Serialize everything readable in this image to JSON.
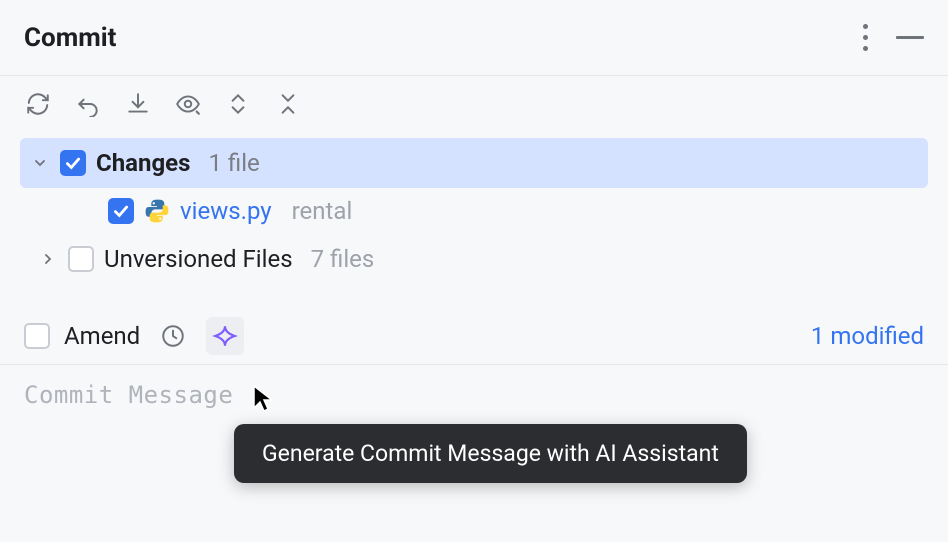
{
  "titleBar": {
    "title": "Commit"
  },
  "changes": {
    "headerLabel": "Changes",
    "headerCount": "1 file",
    "file": {
      "name": "views.py",
      "path": "rental"
    }
  },
  "unversioned": {
    "label": "Unversioned Files",
    "count": "7 files"
  },
  "amend": {
    "label": "Amend",
    "modified": "1 modified"
  },
  "commitMessage": {
    "placeholder": "Commit Message"
  },
  "tooltip": {
    "text": "Generate Commit Message with AI Assistant"
  }
}
